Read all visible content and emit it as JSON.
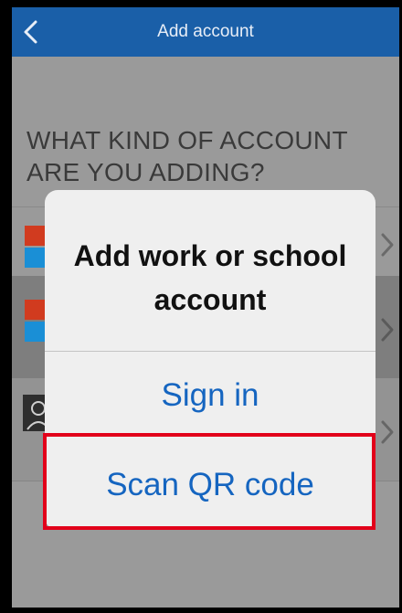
{
  "nav": {
    "title": "Add account",
    "back_icon": "chevron-left-icon"
  },
  "question": "WHAT KIND OF ACCOUNT ARE YOU ADDING?",
  "dialog": {
    "title": "Add work or school account",
    "actions": [
      "Sign in",
      "Scan QR code"
    ]
  },
  "colors": {
    "nav_bar": "#1a5fa8",
    "action_text": "#1565c0",
    "highlight": "#e2001a",
    "logo_red": "#d13b1f",
    "logo_blue": "#1a8fd6"
  }
}
